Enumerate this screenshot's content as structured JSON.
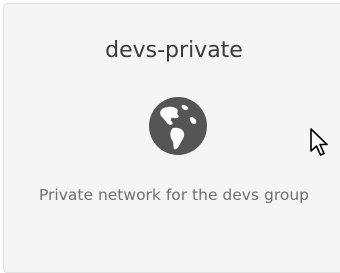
{
  "network_card": {
    "title": "devs-private",
    "icon": "globe-icon",
    "description": "Private network for the devs group"
  },
  "colors": {
    "card_background": "#f5f5f5",
    "card_border": "#e2e2e2",
    "icon": "#555555",
    "title_text": "#3a3a3a",
    "description_text": "#6f6f6f"
  }
}
